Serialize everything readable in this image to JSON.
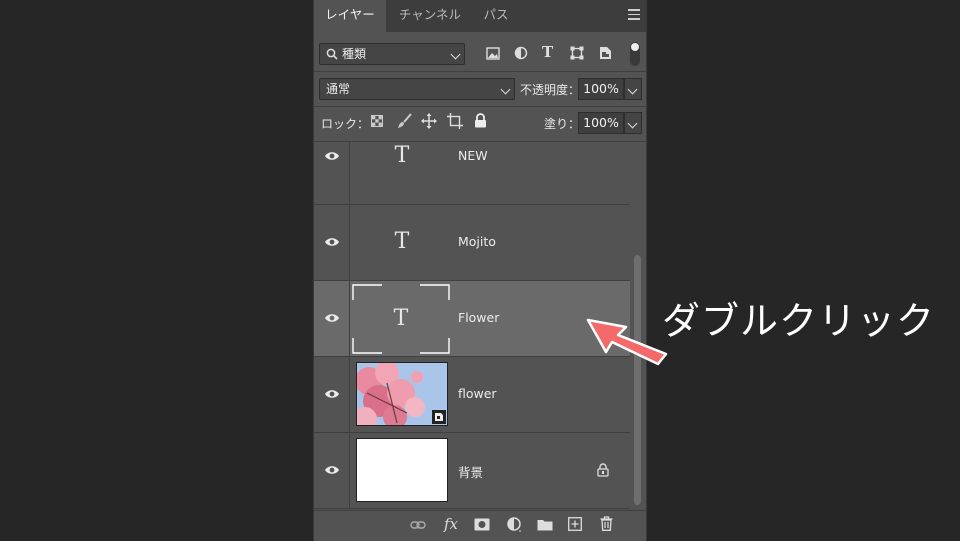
{
  "tabs": [
    {
      "label": "レイヤー",
      "active": true
    },
    {
      "label": "チャンネル",
      "active": false
    },
    {
      "label": "パス",
      "active": false
    }
  ],
  "filter": {
    "kind_label": "種類",
    "icons": [
      "image-filter-icon",
      "adjustment-filter-icon",
      "type-filter-icon",
      "shape-filter-icon",
      "smart-object-filter-icon",
      "filter-toggle"
    ]
  },
  "blend": {
    "mode": "通常",
    "opacity_label": "不透明度：",
    "opacity": "100%"
  },
  "lock": {
    "label": "ロック：",
    "fill_label": "塗り：",
    "fill": "100%"
  },
  "layers": [
    {
      "name": "NEW",
      "type": "text",
      "selected": false,
      "locked": false
    },
    {
      "name": "Mojito",
      "type": "text",
      "selected": false,
      "locked": false
    },
    {
      "name": "Flower",
      "type": "text",
      "selected": true,
      "locked": false
    },
    {
      "name": "flower",
      "type": "smart-object-image",
      "selected": false,
      "locked": false
    },
    {
      "name": "背景",
      "type": "background",
      "selected": false,
      "locked": true
    }
  ],
  "footer_icons": [
    "link-icon",
    "fx-icon",
    "mask-icon",
    "adjustment-layer-icon",
    "group-folder-icon",
    "new-layer-icon",
    "trash-icon"
  ],
  "annotation": {
    "text": "ダブルクリック",
    "arrow_color": "#f26a6a"
  }
}
